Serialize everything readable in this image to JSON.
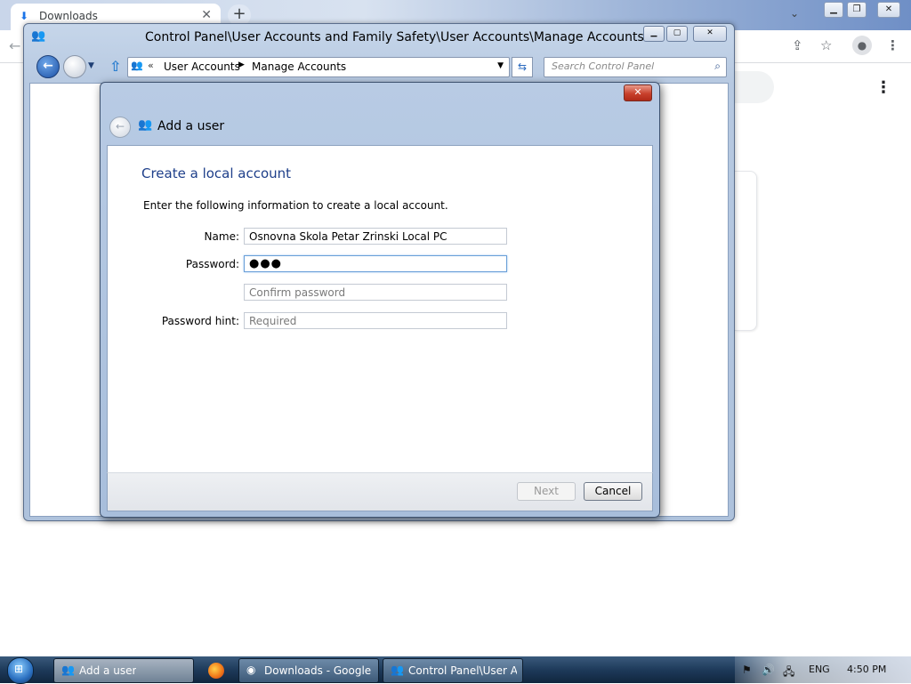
{
  "browser": {
    "tab_title": "Downloads",
    "tab_close": "✕",
    "new_tab": "+"
  },
  "control_panel": {
    "title": "Control Panel\\User Accounts and Family Safety\\User Accounts\\Manage Accounts",
    "breadcrumb": [
      "User Accounts",
      "Manage Accounts"
    ],
    "breadcrumb_prefix": "«",
    "search_placeholder": "Search Control Panel"
  },
  "dialog": {
    "title": "Add a user",
    "heading": "Create a local account",
    "instructions": "Enter the following information to create a local account.",
    "fields": {
      "name_label": "Name:",
      "name_value": "Osnovna Skola Petar Zrinski Local PC",
      "password_label": "Password:",
      "password_masked": "●●●",
      "confirm_placeholder": "Confirm password",
      "hint_label": "Password hint:",
      "hint_placeholder": "Required"
    },
    "buttons": {
      "next": "Next",
      "cancel": "Cancel"
    }
  },
  "taskbar": {
    "items": [
      {
        "label": "Add a user",
        "icon": "user-accounts-icon",
        "active": true
      },
      {
        "label": "",
        "icon": "firefox-icon",
        "active": false
      },
      {
        "label": "Downloads - Google ...",
        "icon": "chrome-icon",
        "active": false
      },
      {
        "label": "Control Panel\\User A...",
        "icon": "user-accounts-icon",
        "active": false
      }
    ],
    "tray": {
      "language": "ENG",
      "time": "4:50 PM"
    }
  },
  "colors": {
    "dialog_heading": "#1e3f8a",
    "taskbar": "#1e3a5a",
    "close_button": "#c8402c"
  }
}
